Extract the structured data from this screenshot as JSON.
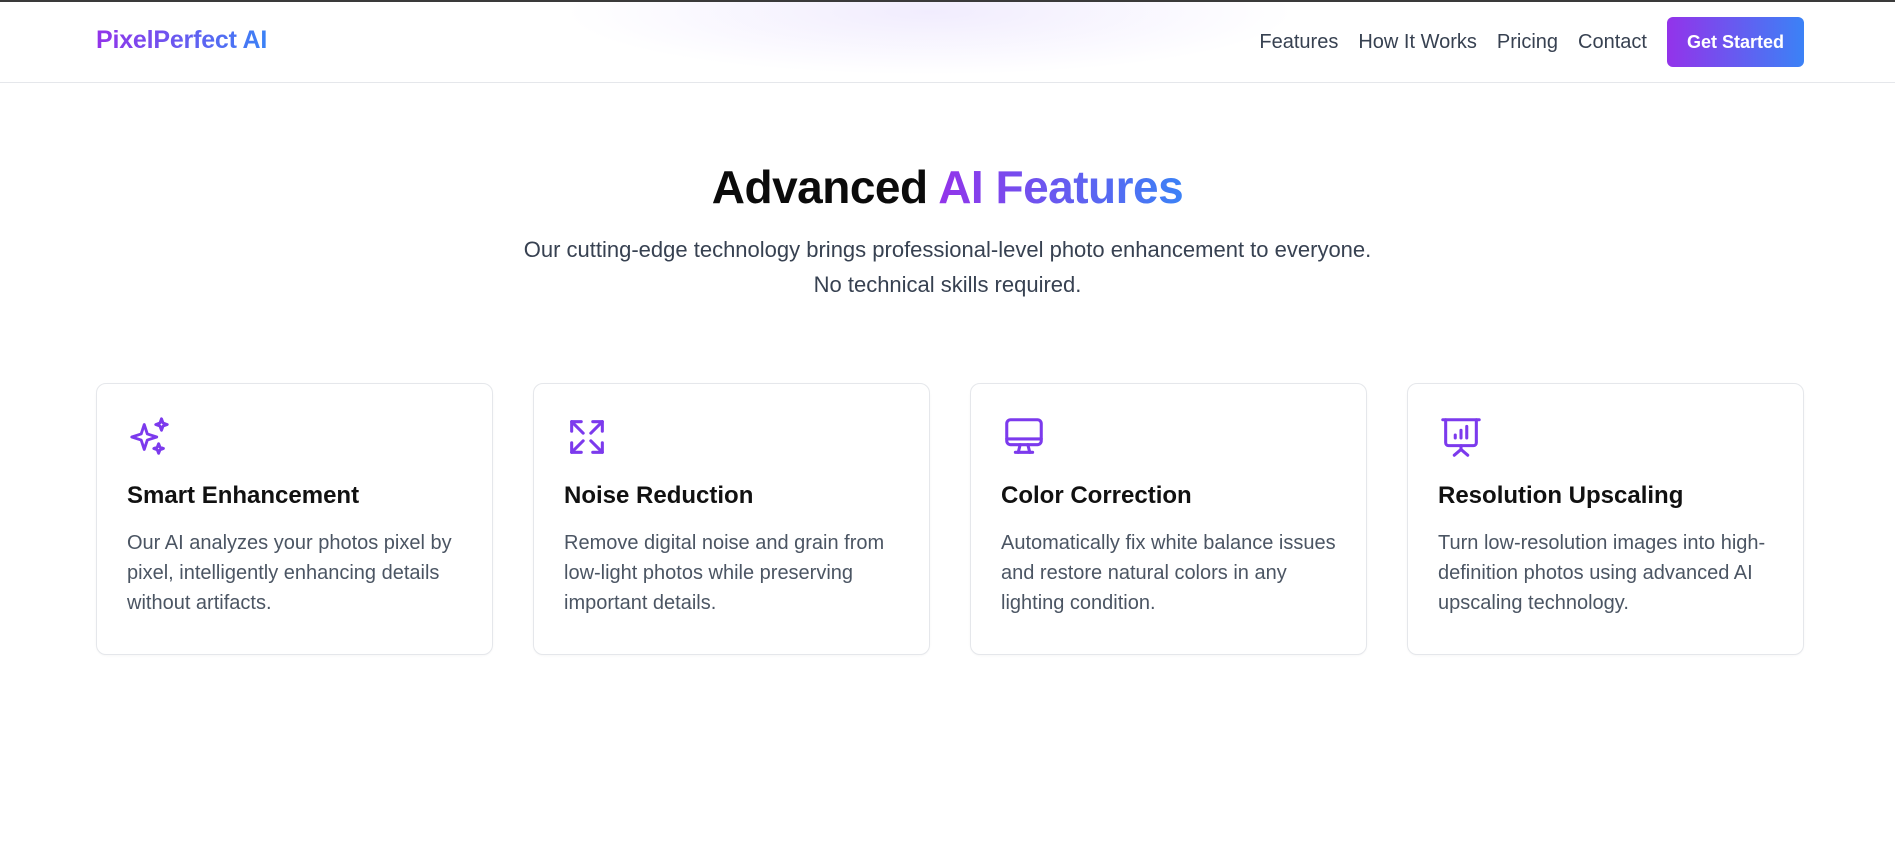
{
  "brand": {
    "logo_text": "PixelPerfect AI"
  },
  "nav": {
    "links": [
      "Features",
      "How It Works",
      "Pricing",
      "Contact"
    ],
    "cta_label": "Get Started"
  },
  "hero": {
    "title_plain": "Advanced ",
    "title_accent": "AI Features",
    "subtitle_line1": "Our cutting-edge technology brings professional-level photo enhancement to everyone.",
    "subtitle_line2": "No technical skills required."
  },
  "features": [
    {
      "icon": "sparkles-icon",
      "title": "Smart Enhancement",
      "description": "Our AI analyzes your photos pixel by pixel, intelligently enhancing details without artifacts."
    },
    {
      "icon": "expand-arrows-icon",
      "title": "Noise Reduction",
      "description": "Remove digital noise and grain from low-light photos while preserving important details."
    },
    {
      "icon": "monitor-icon",
      "title": "Color Correction",
      "description": "Automatically fix white balance issues and restore natural colors in any lighting condition."
    },
    {
      "icon": "presentation-chart-icon",
      "title": "Resolution Upscaling",
      "description": "Turn low-resolution images into high-definition photos using advanced AI upscaling technology."
    }
  ],
  "colors": {
    "gradient_start": "#9333ea",
    "gradient_end": "#3b82f6",
    "icon_color": "#7c3aed"
  }
}
